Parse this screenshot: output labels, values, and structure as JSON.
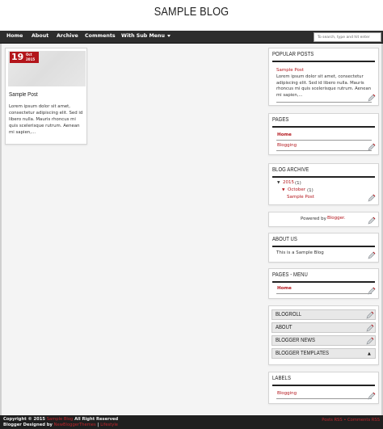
{
  "header": {
    "title": "SAMPLE BLOG"
  },
  "nav": {
    "items": [
      "Home",
      "About",
      "Archive",
      "Comments",
      "With Sub Menu"
    ],
    "search_placeholder": "To search, type and hit enter"
  },
  "post": {
    "date_day": "19",
    "date_month": "Oct",
    "date_year": "2015",
    "title": "Sample Post",
    "excerpt": "Lorem ipsum dolor sit amet, consectetur adipiscing elit. Sed id libero nulla. Mauris rhoncus mi quis scelerisque rutrum. Aenean mi sapien,..."
  },
  "widgets": {
    "popular": {
      "title": "POPULAR POSTS",
      "post_title": "Sample Post",
      "post_excerpt": "Lorem ipsum dolor sit amet, consectetur adipiscing elit. Sed id libero nulla. Mauris rhoncus mi quis scelerisque rutrum. Aenean mi sapien,..."
    },
    "pages": {
      "title": "PAGES",
      "items": [
        "Home",
        "Blogging"
      ]
    },
    "archive": {
      "title": "BLOG ARCHIVE",
      "year": "2015",
      "year_count": "(1)",
      "month": "October",
      "month_count": "(1)",
      "post": "Sample Post"
    },
    "attribution": {
      "prefix": "Powered by",
      "link": "Blogger."
    },
    "about": {
      "title": "ABOUT US",
      "text": "This is a Sample Blog"
    },
    "pages_menu": {
      "title": "PAGES - MENU",
      "items": [
        "Home"
      ]
    },
    "tabs": [
      "BLOGROLL",
      "ABOUT",
      "BLOGGER NEWS",
      "BLOGGER TEMPLATES"
    ],
    "labels": {
      "title": "LABELS",
      "items": [
        "Blogging"
      ]
    }
  },
  "footer": {
    "copyright_prefix": "Copyright © 2015",
    "blog_name": "Sample Blog",
    "copyright_suffix": "All Right Reserved",
    "designed_prefix": "Blogger Designed by",
    "designer": "NewBloggerThemes",
    "separator": "|",
    "designer2": "Lifestyle",
    "feed_posts": "Posts RSS",
    "feed_bullet": "•",
    "feed_comments": "Comments RSS"
  },
  "colors": {
    "accent": "#b3151b",
    "nav_bg": "#2d2d2d",
    "footer_bg": "#1f1f1f"
  }
}
